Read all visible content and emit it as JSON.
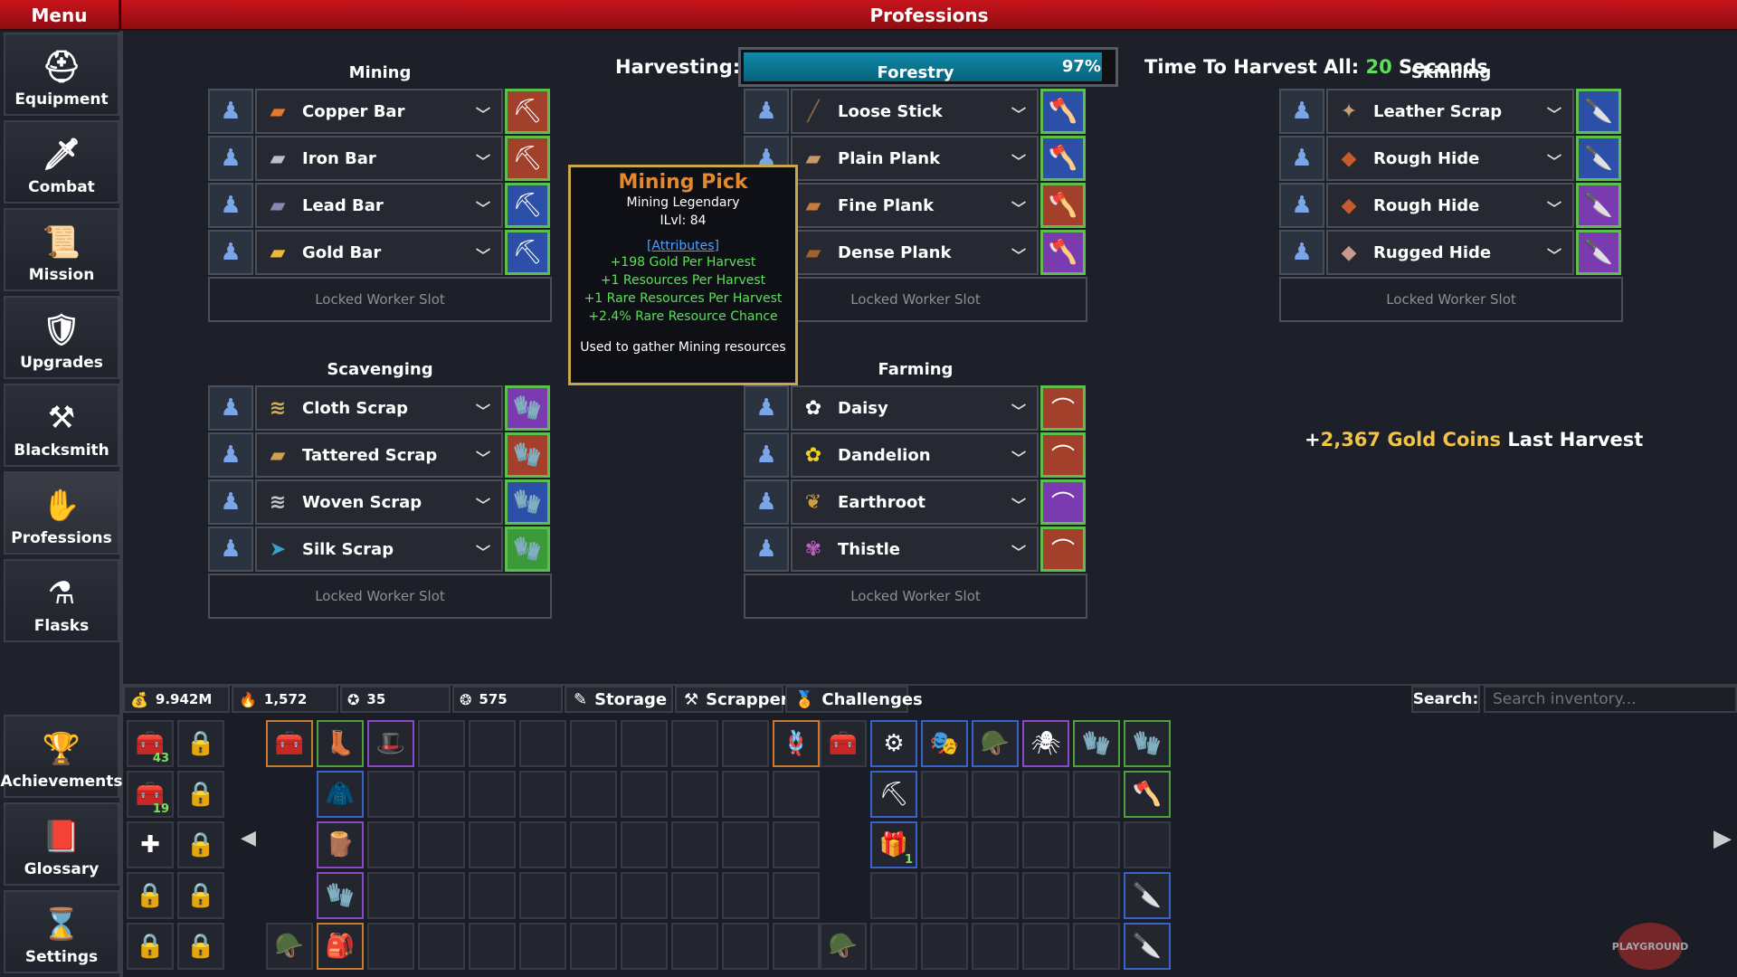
{
  "menu_title": "Menu",
  "page_title": "Professions",
  "sidebar": [
    {
      "label": "Equipment",
      "icon": "⛑"
    },
    {
      "label": "Combat",
      "icon": "🗡"
    },
    {
      "label": "Mission",
      "icon": "📜"
    },
    {
      "label": "Upgrades",
      "icon": "🛡"
    },
    {
      "label": "Blacksmith",
      "icon": "⚒"
    },
    {
      "label": "Professions",
      "icon": "✋"
    },
    {
      "label": "Flasks",
      "icon": "⚗"
    },
    {
      "label": "Achievements",
      "icon": "🏆"
    },
    {
      "label": "Glossary",
      "icon": "📕"
    },
    {
      "label": "Settings",
      "icon": "⌛"
    }
  ],
  "harvest": {
    "label": "Harvesting:",
    "progress_pct": 97,
    "progress_text": "97%",
    "time_prefix": "Time To Harvest All:",
    "time_value": "20",
    "time_suffix": "Seconds"
  },
  "professions": [
    {
      "title": "Mining",
      "rows": [
        {
          "name": "Copper Bar",
          "icon": "▰",
          "icolor": "#e57a2e",
          "tool": "⛏",
          "tbg": "#a2402c"
        },
        {
          "name": "Iron Bar",
          "icon": "▰",
          "icolor": "#b8c0c8",
          "tool": "⛏",
          "tbg": "#a2402c"
        },
        {
          "name": "Lead Bar",
          "icon": "▰",
          "icolor": "#8a86b8",
          "tool": "⛏",
          "tbg": "#2c4fa8"
        },
        {
          "name": "Gold Bar",
          "icon": "▰",
          "icolor": "#f0b83a",
          "tool": "⛏",
          "tbg": "#2c4fa8"
        }
      ],
      "locked": "Locked Worker Slot"
    },
    {
      "title": "Forestry",
      "rows": [
        {
          "name": "Loose Stick",
          "icon": "╱",
          "icolor": "#8a6a40",
          "tool": "🪓",
          "tbg": "#2c4fa8"
        },
        {
          "name": "Plain Plank",
          "icon": "▰",
          "icolor": "#c8986a",
          "tool": "🪓",
          "tbg": "#2c4fa8"
        },
        {
          "name": "Fine Plank",
          "icon": "▰",
          "icolor": "#c87a40",
          "tool": "🪓",
          "tbg": "#a2402c"
        },
        {
          "name": "Dense Plank",
          "icon": "▰",
          "icolor": "#a06030",
          "tool": "🪓",
          "tbg": "#7a3ab0"
        }
      ],
      "locked": "Locked Worker Slot"
    },
    {
      "title": "Skinning",
      "rows": [
        {
          "name": "Leather Scrap",
          "icon": "✦",
          "icolor": "#c8a070",
          "tool": "🔪",
          "tbg": "#2c4fa8"
        },
        {
          "name": "Rough Hide",
          "icon": "◆",
          "icolor": "#c85a30",
          "tool": "🔪",
          "tbg": "#2c4fa8"
        },
        {
          "name": "Rough Hide",
          "icon": "◆",
          "icolor": "#c85a30",
          "tool": "🔪",
          "tbg": "#7a3ab0"
        },
        {
          "name": "Rugged Hide",
          "icon": "◆",
          "icolor": "#c89a8a",
          "tool": "🔪",
          "tbg": "#7a3ab0"
        }
      ],
      "locked": "Locked Worker Slot"
    },
    {
      "title": "Scavenging",
      "rows": [
        {
          "name": "Cloth Scrap",
          "icon": "≋",
          "icolor": "#d0b060",
          "tool": "🧤",
          "tbg": "#7a3ab0"
        },
        {
          "name": "Tattered Scrap",
          "icon": "▰",
          "icolor": "#d0a050",
          "tool": "🧤",
          "tbg": "#a2402c"
        },
        {
          "name": "Woven Scrap",
          "icon": "≋",
          "icolor": "#c8c8c8",
          "tool": "🧤",
          "tbg": "#2c4fa8"
        },
        {
          "name": "Silk Scrap",
          "icon": "➤",
          "icolor": "#3aa0c8",
          "tool": "🧤",
          "tbg": "#3a9a3a"
        }
      ],
      "locked": "Locked Worker Slot"
    },
    {
      "title": "Farming",
      "rows": [
        {
          "name": "Daisy",
          "icon": "✿",
          "icolor": "#ffffff",
          "tool": "⌒",
          "tbg": "#a2402c"
        },
        {
          "name": "Dandelion",
          "icon": "✿",
          "icolor": "#f0d020",
          "tool": "⌒",
          "tbg": "#a2402c"
        },
        {
          "name": "Earthroot",
          "icon": "❦",
          "icolor": "#d0a040",
          "tool": "⌒",
          "tbg": "#7a3ab0"
        },
        {
          "name": "Thistle",
          "icon": "✾",
          "icolor": "#c060c0",
          "tool": "⌒",
          "tbg": "#a2402c"
        }
      ],
      "locked": "Locked Worker Slot"
    }
  ],
  "tooltip": {
    "name": "Mining Pick",
    "subtitle": "Mining Legendary",
    "ilvl": "ILvl: 84",
    "attr_header": "[Attributes]",
    "attrs": [
      "+198 Gold Per Harvest",
      "+1 Resources Per Harvest",
      "+1 Rare Resources Per Harvest",
      "+2.4% Rare Resource Chance"
    ],
    "footer": "Used to gather Mining resources"
  },
  "last_harvest": {
    "prefix": "+",
    "amount": "2,367 Gold Coins",
    "suffix": "Last Harvest"
  },
  "currencies": [
    {
      "value": "9.942M",
      "icon": "💰"
    },
    {
      "value": "1,572",
      "icon": "🔥"
    },
    {
      "value": "35",
      "icon": "✪"
    },
    {
      "value": "575",
      "icon": "❂"
    }
  ],
  "tabs": [
    {
      "label": "Storage",
      "icon": "✎"
    },
    {
      "label": "Scrapper",
      "icon": "⚒"
    },
    {
      "label": "Challenges",
      "icon": "🏅"
    }
  ],
  "search": {
    "label": "Search:",
    "placeholder": "Search inventory..."
  },
  "inventory_counts": {
    "chest1": "43",
    "chest2": "19",
    "redchest": "1"
  },
  "watermark": "PLAYGROUND"
}
